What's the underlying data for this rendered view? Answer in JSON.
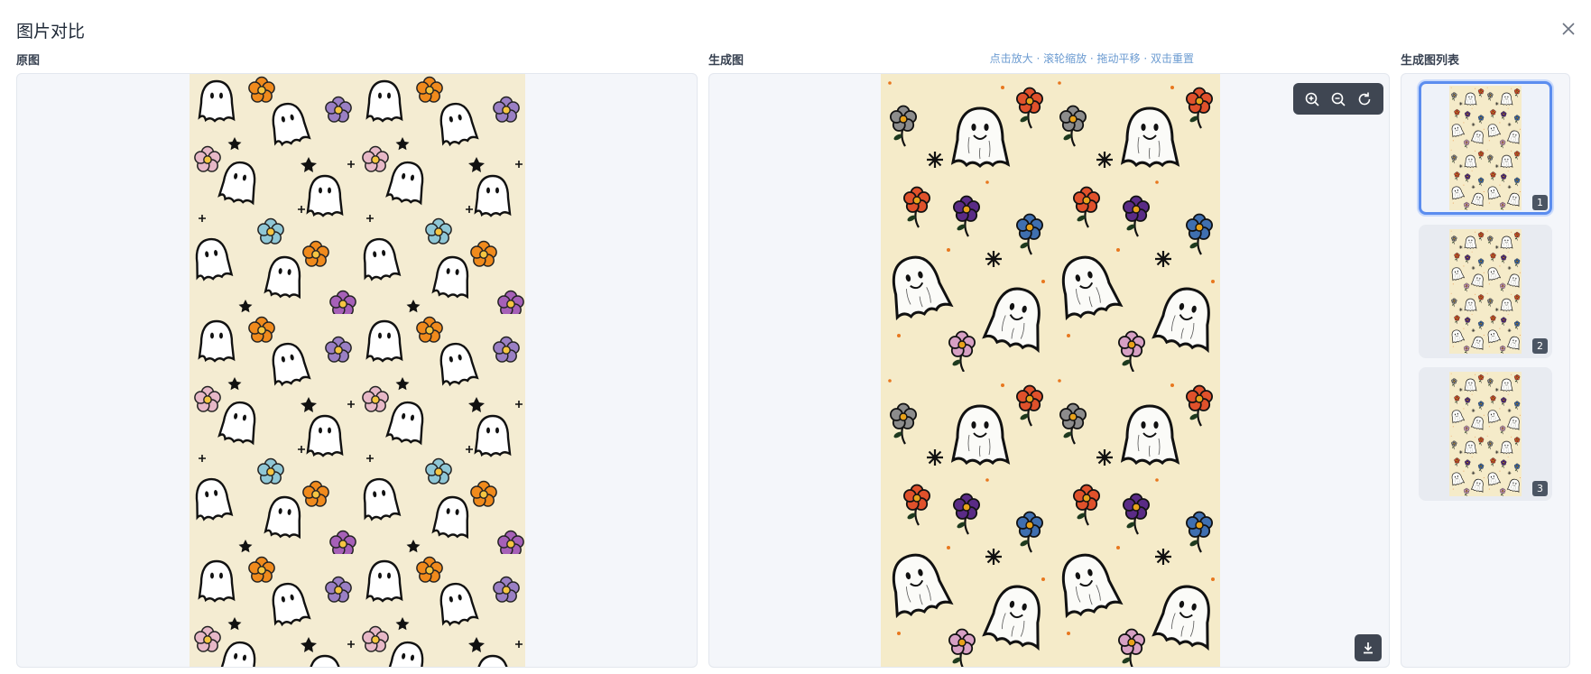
{
  "dialog": {
    "title": "图片对比"
  },
  "original": {
    "label": "原图"
  },
  "generated": {
    "label": "生成图",
    "hint": "点击放大 · 滚轮缩放 · 拖动平移 · 双击重置"
  },
  "list": {
    "label": "生成图列表",
    "items": [
      {
        "index": "1",
        "selected": true
      },
      {
        "index": "2",
        "selected": false
      },
      {
        "index": "3",
        "selected": false
      }
    ]
  },
  "toolbar": {
    "icons": [
      "zoom-in-icon",
      "zoom-out-icon",
      "reset-icon"
    ]
  },
  "colors": {
    "accent": "#5b8def",
    "panel_bg": "#f4f6fa",
    "cream": "#f4ecd2"
  }
}
